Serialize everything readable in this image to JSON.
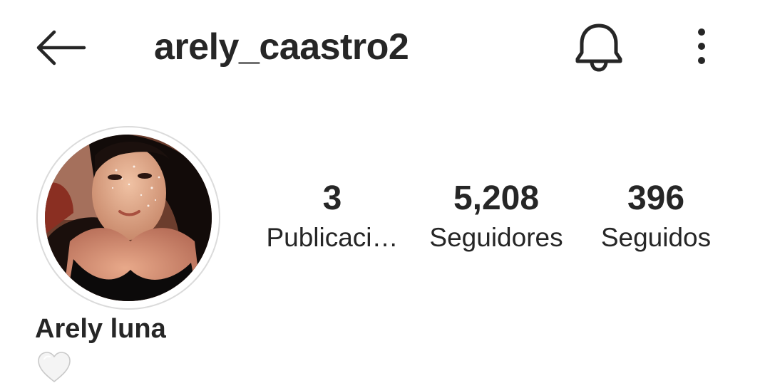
{
  "header": {
    "username": "arely_caastro2",
    "back_icon": "arrow-left-icon",
    "notification_icon": "bell-icon",
    "more_icon": "more-vertical-icon"
  },
  "profile": {
    "display_name": "Arely luna",
    "bio": "🤍",
    "avatar_icon": "profile-avatar"
  },
  "stats": {
    "posts": {
      "count": "3",
      "label": "Publicaci…"
    },
    "followers": {
      "count": "5,208",
      "label": "Seguidores"
    },
    "following": {
      "count": "396",
      "label": "Seguidos"
    }
  },
  "colors": {
    "text": "#262626",
    "avatar_ring": "#dbdbdb",
    "background": "#ffffff"
  }
}
